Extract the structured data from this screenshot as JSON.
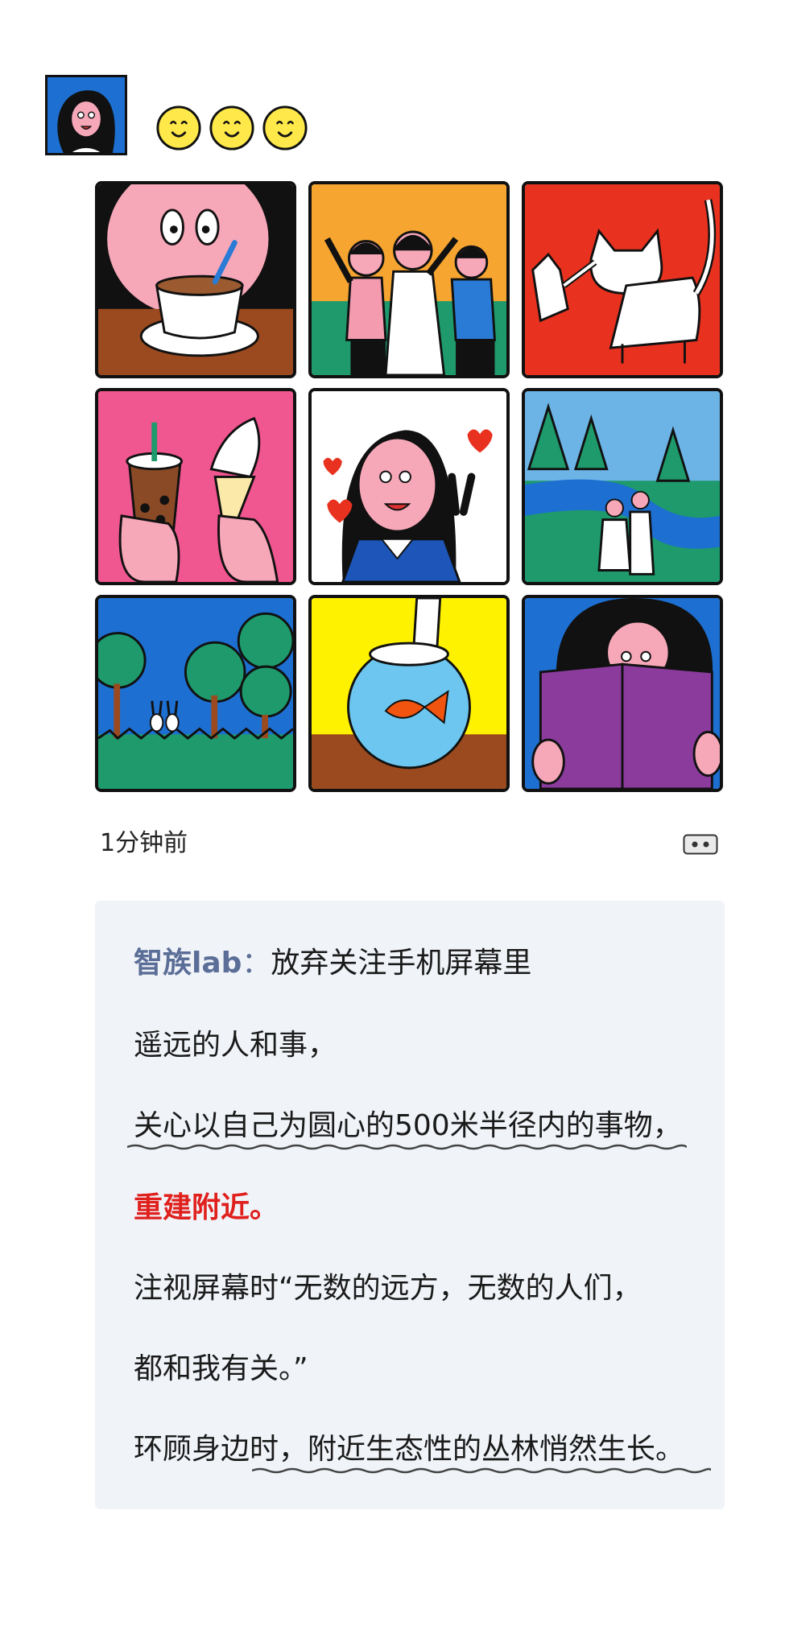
{
  "post": {
    "timestamp": "1分钟前"
  },
  "comment": {
    "author": "智族lab",
    "separator": "：",
    "line1": "放弃关注手机屏幕里",
    "line2": "遥远的人和事，",
    "line3": "关心以自己为圆心的500米半径内的事物，",
    "line4": "重建附近。",
    "line5": "注视屏幕时“无数的远方，无数的人们，",
    "line6": "都和我有关。”",
    "line7": "环顾身边时，附近生态性的丛林悄然生长。"
  },
  "icons": {
    "avatar": "avatar-illustration",
    "reactions": [
      "smiley-icon",
      "smiley-icon",
      "smiley-icon"
    ],
    "comment": "comment-icon"
  },
  "colors": {
    "author": "#5b6e97",
    "highlight": "#e0201d",
    "comment_bg": "#f0f3f8",
    "smiley": "#ffe94a"
  }
}
